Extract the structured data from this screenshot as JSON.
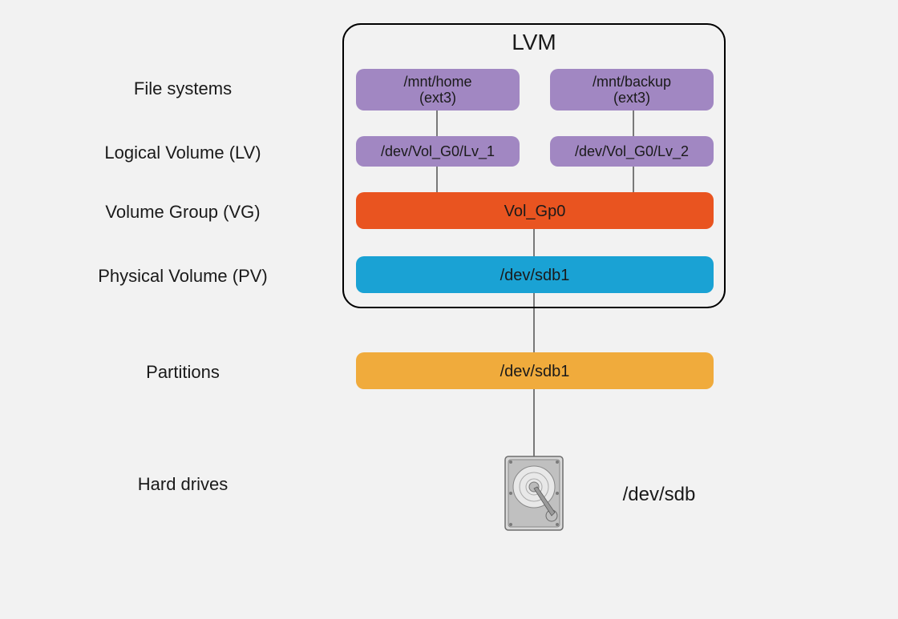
{
  "title": "LVM",
  "row_labels": {
    "file_systems": "File systems",
    "logical_volume": "Logical Volume (LV)",
    "volume_group": "Volume Group (VG)",
    "physical_volume": "Physical Volume (PV)",
    "partitions": "Partitions",
    "hard_drives": "Hard drives"
  },
  "boxes": {
    "fs1_path": "/mnt/home",
    "fs1_type": "(ext3)",
    "fs2_path": "/mnt/backup",
    "fs2_type": "(ext3)",
    "lv1": "/dev/Vol_G0/Lv_1",
    "lv2": "/dev/Vol_G0/Lv_2",
    "vg": "Vol_Gp0",
    "pv": "/dev/sdb1",
    "partition": "/dev/sdb1",
    "drive": "/dev/sdb"
  },
  "colors": {
    "purple": "#a187c2",
    "orange": "#e95420",
    "blue": "#1aa2d4",
    "yellow": "#f0ab3c",
    "stroke": "#000000"
  }
}
